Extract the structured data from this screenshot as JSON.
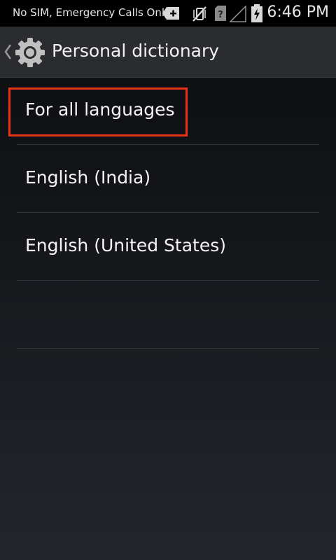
{
  "status_bar": {
    "carrier_text": "No SIM, Emergency Calls Only",
    "time": "6:46 PM",
    "icons": [
      "download-icon",
      "vibrate-off-icon",
      "no-sim-icon",
      "no-signal-icon",
      "battery-charging-icon"
    ]
  },
  "action_bar": {
    "title": "Personal dictionary",
    "icon": "settings-gear-icon"
  },
  "list": {
    "items": [
      {
        "label": "For all languages"
      },
      {
        "label": "English (India)"
      },
      {
        "label": "English (United States)"
      },
      {
        "label": ""
      }
    ]
  },
  "colors": {
    "highlight": "#e8321a",
    "action_bar": "#2a2c30",
    "status_bar": "#000000"
  }
}
